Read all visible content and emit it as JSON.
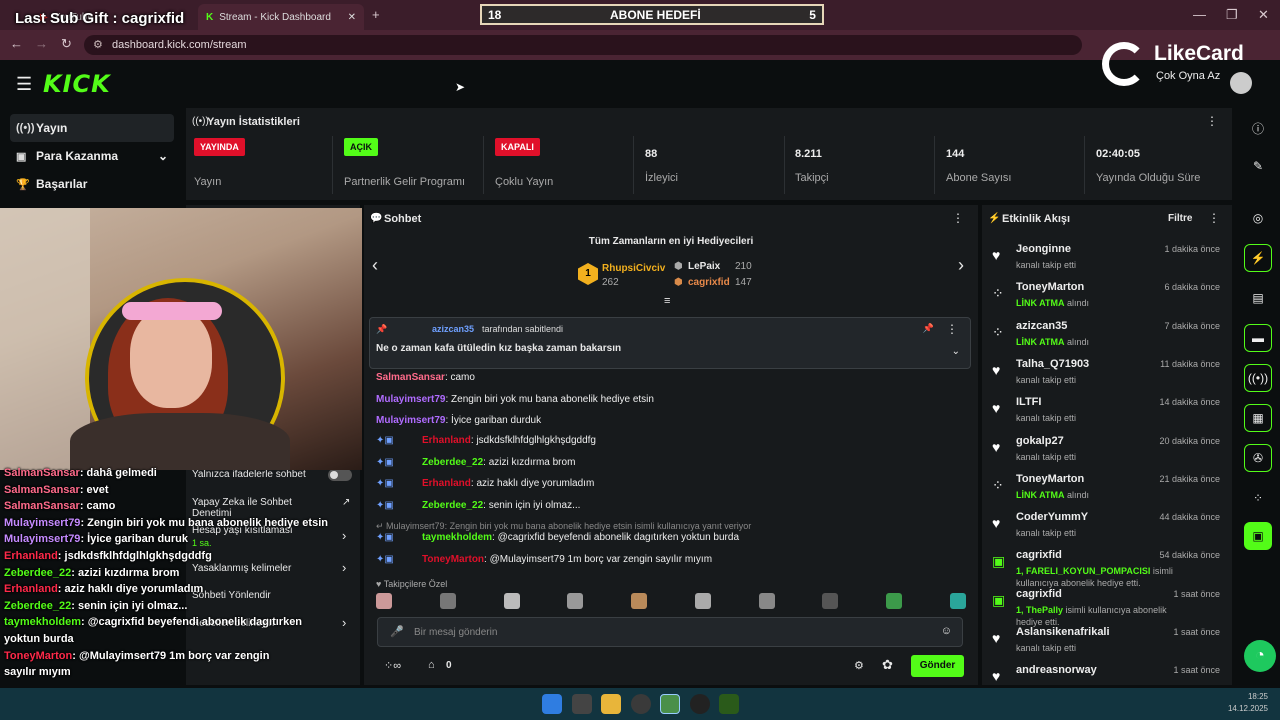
{
  "overlay": {
    "last_sub": "Last Sub Gift : cagrixfid",
    "goal_left": "18",
    "goal_title": "ABONE HEDEFİ",
    "goal_right": "5",
    "sponsor_name": "LikeCard",
    "sponsor_tag": "Çok Oyna  Az"
  },
  "browser": {
    "tabs": [
      {
        "label": "YouTube"
      },
      {
        "label": "Stream - Kick Dashboard"
      }
    ],
    "url": "dashboard.kick.com/stream"
  },
  "sidebar": {
    "items": [
      {
        "label": "Yayın",
        "icon": "broadcast-icon"
      },
      {
        "label": "Para Kazanma",
        "icon": "money-icon"
      },
      {
        "label": "Başarılar",
        "icon": "trophy-icon"
      }
    ]
  },
  "stats": {
    "title": "Yayın İstatistikleri",
    "items": [
      {
        "value": "YAYINDA",
        "label": "Yayın",
        "badge_color": "#e0102a"
      },
      {
        "value": "AÇIK",
        "label": "Partnerlik Gelir Programı",
        "badge_color": "#53fc18"
      },
      {
        "value": "KAPALI",
        "label": "Çoklu Yayın",
        "badge_color": "#e0102a"
      },
      {
        "value": "88",
        "label": "İzleyici"
      },
      {
        "value": "8.211",
        "label": "Takipçi"
      },
      {
        "value": "144",
        "label": "Abone Sayısı"
      },
      {
        "value": "02:40:05",
        "label": "Yayında Olduğu Süre"
      }
    ]
  },
  "chat": {
    "title": "Sohbet",
    "gifters_title": "Tüm Zamanların en iyi Hediyecileri",
    "gifters": [
      {
        "name": "RhupsiCivciv",
        "count": "262"
      },
      {
        "name": "LePaix",
        "count": "210"
      },
      {
        "name": "cagrixfid",
        "count": "147"
      }
    ],
    "pinned_by": "azizcan35",
    "pinned_suffix": "tarafından sabitlendi",
    "pinned_text": "Ne o zaman kafa ütüledin kız başka zaman bakarsın",
    "messages": [
      {
        "user": "SalmanSansar",
        "color": "#ff6b8b",
        "text": ": camo"
      },
      {
        "user": "Mulayimsert79",
        "color": "#b06cff",
        "text": ": Zengin biri yok mu bana abonelik hediye etsin"
      },
      {
        "user": "Mulayimsert79",
        "color": "#b06cff",
        "text": ": İyice gariban durduk"
      },
      {
        "user": "Erhanland",
        "color": "#e0102a",
        "text": ": jsdkdsfklhfdglhlgkhşdgddfg"
      },
      {
        "user": "Zeberdee_22",
        "color": "#53fc18",
        "text": ": azizi kızdırma brom"
      },
      {
        "user": "Erhanland",
        "color": "#e0102a",
        "text": ": aziz haklı diye yorumladım"
      },
      {
        "user": "Zeberdee_22",
        "color": "#53fc18",
        "text": ": senin için iyi olmaz..."
      },
      {
        "user": "taymekholdem",
        "color": "#53fc18",
        "text": ": @cagrixfid beyefendi abonelik dagıtırken yoktun burda"
      },
      {
        "user": "ToneyMarton",
        "color": "#e0102a",
        "text": ": @Mulayimsert79 1m borç var zengin sayılır mıyım"
      }
    ],
    "reply_hint": "Mulayimsert79: Zengin biri yok mu bana abonelik hediye etsin isimli kullanıcıya yanıt veriyor",
    "followers_only": "Takipçilere Özel",
    "input_placeholder": "Bir mesaj gönderin",
    "points": "0",
    "send_label": "Gönder"
  },
  "activity": {
    "title": "Etkinlik Akışı",
    "filter": "Filtre",
    "items": [
      {
        "name": "Jeonginne",
        "time": "1 dakika önce",
        "sub": "kanalı takip etti",
        "type": "follow"
      },
      {
        "name": "ToneyMarton",
        "time": "6 dakika önce",
        "sub_green": "LİNK ATMA",
        "sub": " alındı",
        "type": "reward"
      },
      {
        "name": "azizcan35",
        "time": "7 dakika önce",
        "sub_green": "LİNK ATMA",
        "sub": " alındı",
        "type": "reward"
      },
      {
        "name": "Talha_Q71903",
        "time": "11 dakika önce",
        "sub": "kanalı takip etti",
        "type": "follow"
      },
      {
        "name": "ILTFI",
        "time": "14 dakika önce",
        "sub": "kanalı takip etti",
        "type": "follow"
      },
      {
        "name": "gokalp27",
        "time": "20 dakika önce",
        "sub": "kanalı takip etti",
        "type": "follow"
      },
      {
        "name": "ToneyMarton",
        "time": "21 dakika önce",
        "sub_green": "LİNK ATMA",
        "sub": " alındı",
        "type": "reward"
      },
      {
        "name": "CoderYummY",
        "time": "44 dakika önce",
        "sub": "kanalı takip etti",
        "type": "follow"
      },
      {
        "name": "cagrixfid",
        "time": "54 dakika önce",
        "sub_green": "1, FARELI_KOYUN_POMPACISI",
        "sub": " isimli kullanıcıya abonelik hediye etti.",
        "type": "gift"
      },
      {
        "name": "cagrixfid",
        "time": "1 saat önce",
        "sub_green": "1, ThePally",
        "sub": " isimli kullanıcıya abonelik hediye etti.",
        "type": "gift"
      },
      {
        "name": "Aslansikenafrikali",
        "time": "1 saat önce",
        "sub": "kanalı takip etti",
        "type": "follow"
      },
      {
        "name": "andreasnorway",
        "time": "1 saat önce",
        "sub": "",
        "type": "follow"
      }
    ]
  },
  "settings_panel": {
    "items": [
      "Yalnızca ifadelerle sohbet",
      "Yapay Zeka ile Sohbet Denetimi",
      "Hesap yaşı kısıtlaması",
      "1 sa.",
      "Yasaklanmış kelimeler",
      "Sohbeti Yönlendir",
      "Hedefleri belirleyin"
    ]
  },
  "overlay_chat": [
    {
      "user": "SalmanSansar",
      "color": "#ff6b8b",
      "text": ": dahâ gelmedi"
    },
    {
      "user": "SalmanSansar",
      "color": "#ff6b8b",
      "text": ": evet"
    },
    {
      "user": "SalmanSansar",
      "color": "#ff6b8b",
      "text": ": camo"
    },
    {
      "user": "Mulayimsert79",
      "color": "#c58bff",
      "text": ": Zengin biri yok mu bana abonelik hediye etsin"
    },
    {
      "user": "Mulayimsert79",
      "color": "#c58bff",
      "text": ": İyice gariban duruk"
    },
    {
      "user": "Erhanland",
      "color": "#ff2a4a",
      "text": ": jsdkdsfklhfdglhlgkhşdgddfg"
    },
    {
      "user": "Zeberdee_22",
      "color": "#53fc18",
      "text": ": azizi kızdırma brom"
    },
    {
      "user": "Erhanland",
      "color": "#ff2a4a",
      "text": ": aziz haklı diye yorumladım"
    },
    {
      "user": "Zeberdee_22",
      "color": "#53fc18",
      "text": ": senin için iyi olmaz..."
    },
    {
      "user": "taymekholdem",
      "color": "#53fc18",
      "text": ": @cagrixfid beyefendi abonelik dagıtırken"
    },
    {
      "user": "",
      "color": "#fff",
      "text": "yoktun burda"
    },
    {
      "user": "ToneyMarton",
      "color": "#ff2a4a",
      "text": ": @Mulayimsert79 1m borç var zengin"
    },
    {
      "user": "",
      "color": "#fff",
      "text": "sayılır mıyım"
    }
  ],
  "taskbar": {
    "time": "18:25",
    "date": "14.12.2025"
  }
}
